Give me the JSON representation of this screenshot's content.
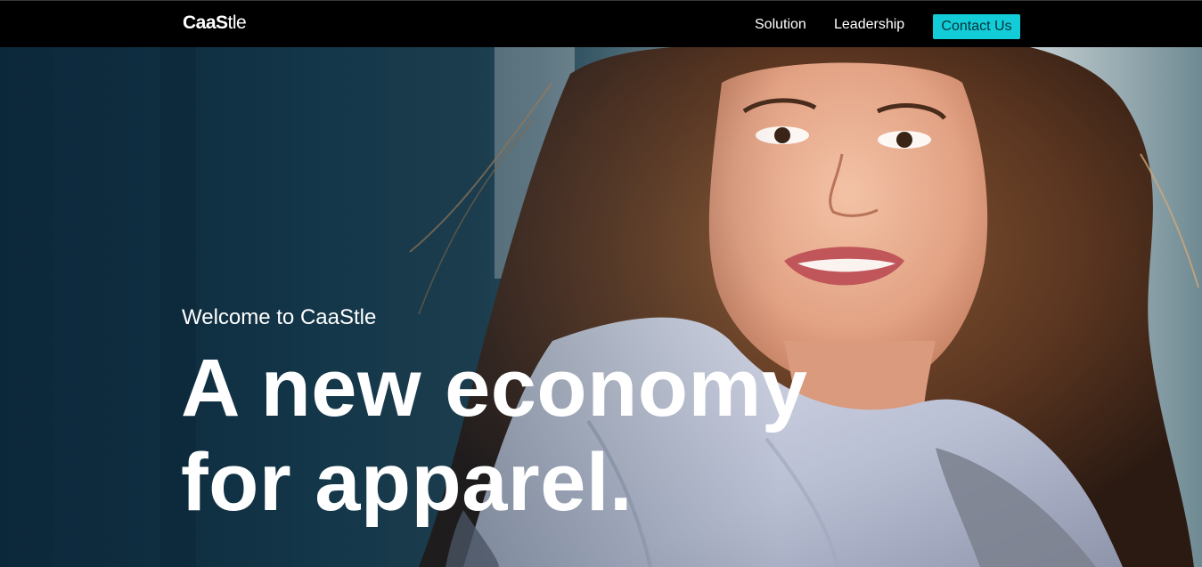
{
  "header": {
    "logo_bold": "CaaS",
    "logo_light": "tle",
    "nav": {
      "solution": "Solution",
      "leadership": "Leadership",
      "contact": "Contact Us"
    }
  },
  "hero": {
    "welcome": "Welcome to CaaStle",
    "headline_line1": "A new economy",
    "headline_line2": "for apparel."
  },
  "colors": {
    "header_bg": "#000000",
    "contact_button_bg": "#12ccd8",
    "text": "#ffffff"
  }
}
